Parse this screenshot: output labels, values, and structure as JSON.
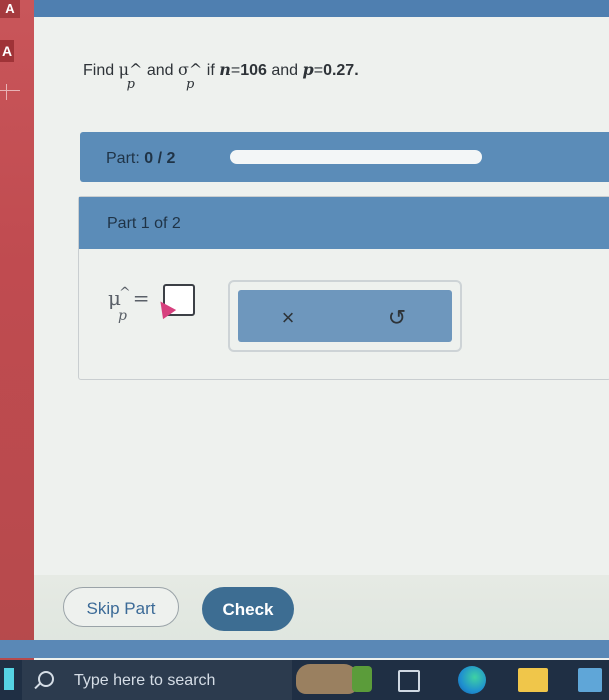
{
  "question": {
    "find_label": "Find",
    "mu_symbol": "μ",
    "hat": "^",
    "sub_p": "p",
    "and_label": "and",
    "sigma_symbol": "σ",
    "if_label": "if",
    "n_var": "n",
    "equals": "=",
    "n_value": "106",
    "and2_label": "and",
    "p_var": "p",
    "p_value": "0.27."
  },
  "progress": {
    "part_label": "Part:",
    "part_value": "0 / 2",
    "fraction": 0.0
  },
  "part_card": {
    "title": "Part 1 of 2"
  },
  "answer": {
    "mu_symbol": "μ",
    "sub_p": "p",
    "equals": "="
  },
  "tools": {
    "clear_icon": "×",
    "undo_icon": "↺"
  },
  "actions": {
    "skip_label": "Skip Part",
    "check_label": "Check"
  },
  "taskbar": {
    "search_placeholder": "Type here to search"
  },
  "left_window": {
    "badge_top": "A",
    "badge_mid": "A"
  },
  "colors": {
    "accent": "#5b8cb8",
    "check_button": "#3d6d92",
    "taskbar": "#1f2f44"
  }
}
